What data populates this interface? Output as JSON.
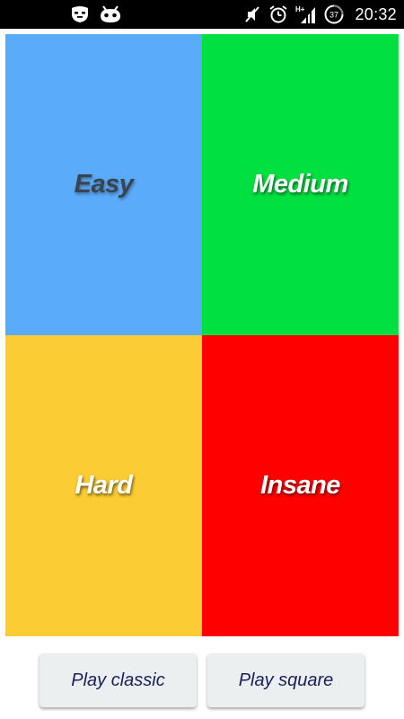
{
  "status_bar": {
    "time": "20:32",
    "battery_level": "37",
    "left_icons": [
      "privacy-guard-icon",
      "android-debug-icon"
    ],
    "right_icons": [
      "mute-icon",
      "alarm-icon",
      "signal-icon",
      "battery-icon"
    ]
  },
  "tiles": [
    {
      "label": "Easy",
      "color": "#5aabfa"
    },
    {
      "label": "Medium",
      "color": "#00e040"
    },
    {
      "label": "Hard",
      "color": "#fbcc33"
    },
    {
      "label": "Insane",
      "color": "#ff0000"
    }
  ],
  "buttons": {
    "classic_label": "Play classic",
    "square_label": "Play square"
  }
}
